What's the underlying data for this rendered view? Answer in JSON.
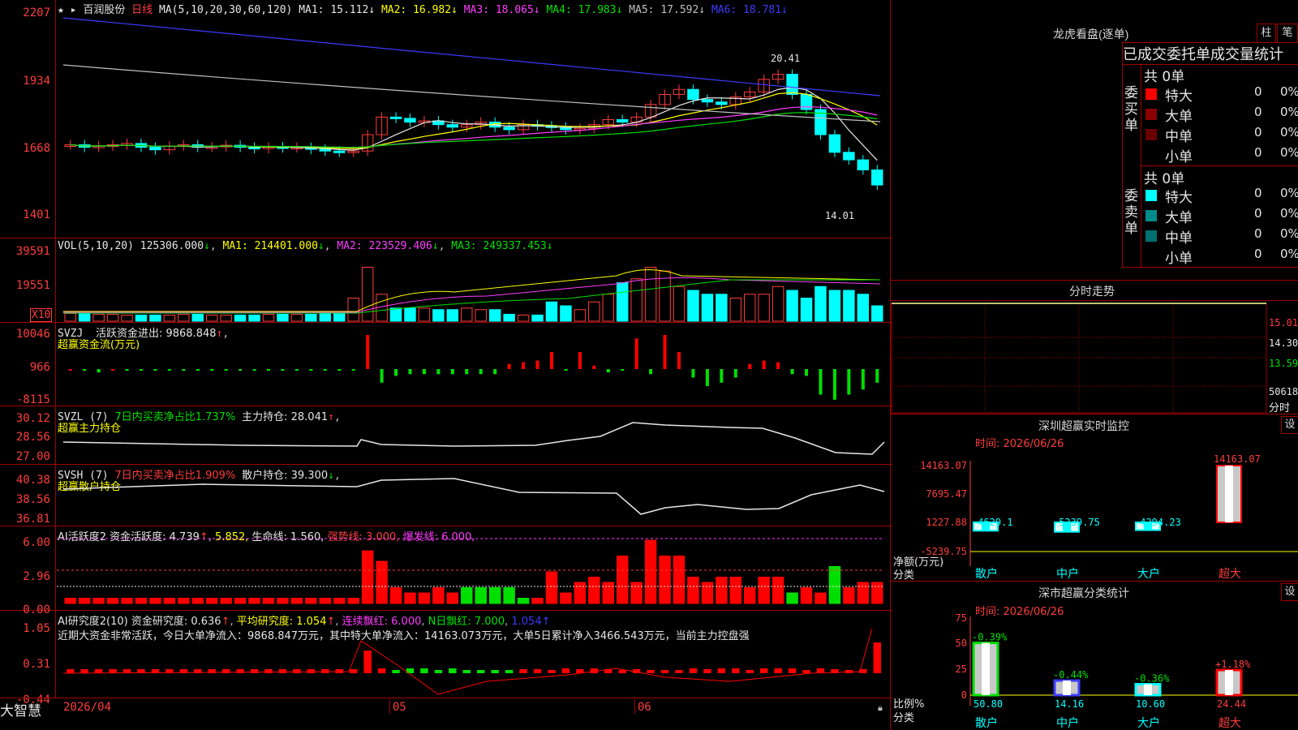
{
  "stock": {
    "name": "百润股份",
    "period": "日线",
    "ma_header": "MA(5,10,20,30,60,120)"
  },
  "ma_values": [
    {
      "label": "MA1: 15.112",
      "color": "#e6e6e6"
    },
    {
      "label": "MA2: 16.982",
      "color": "#ffff00"
    },
    {
      "label": "MA3: 18.065",
      "color": "#ff3cff"
    },
    {
      "label": "MA4: 17.983",
      "color": "#00e000"
    },
    {
      "label": "MA5: 17.592",
      "color": "#c0c0c0"
    },
    {
      "label": "MA6: 18.781",
      "color": "#3c3cff"
    }
  ],
  "price_axis": [
    "2207",
    "1934",
    "1668",
    "1401"
  ],
  "price_marks": {
    "high": "20.41",
    "low": "14.01"
  },
  "vol": {
    "header": "VOL(5,10,20)",
    "v": "125306.000",
    "ma1": "MA1: 214401.000",
    "ma2": "MA2: 223529.406",
    "ma3": "MA3: 249337.453",
    "axis": [
      "39591",
      "19551"
    ],
    "unit": "X10"
  },
  "svzj": {
    "header": "SVZJ",
    "line1": "活跃资金进出: 9868.848",
    "sub": "超赢资金流(万元)",
    "axis": [
      "10046",
      "966",
      "-8115"
    ]
  },
  "svzl": {
    "header": "SVZL (7)",
    "t1": "7日内买卖净占比1.737%",
    "t2": "主力持仓: 28.041",
    "sub": "超赢主力持仓",
    "axis": [
      "30.12",
      "28.56",
      "27.00"
    ]
  },
  "svsh": {
    "header": "SVSH (7)",
    "t1": "7日内买卖净占比1.909%",
    "t2": "散户持仓: 39.300",
    "sub": "超赢散户持仓",
    "axis": [
      "40.38",
      "38.56",
      "36.81"
    ]
  },
  "ai1": {
    "header": "AI活跃度2",
    "t1": "资金活跃度: 4.739",
    "t2": "5.852,",
    "t3": "生命线: 1.560,",
    "t4": "强势线: 3.000,",
    "t5": "爆发线: 6.000,",
    "axis": [
      "6.00",
      "2.96",
      "0.00"
    ]
  },
  "ai2": {
    "header": "AI研究度2(10)",
    "t1": "资金研究度: 0.636",
    "t2": "平均研究度: 1.054",
    "t3": "连续飘红: 6.000",
    "t4": "N日飘红: 7.000",
    "t5": "1.054",
    "note": "近期大资金非常活跃，今日大单净流入：9868.847万元，其中特大单净流入：14163.073万元，大单5日累计净入3466.543万元，当前主力控盘强",
    "axis": [
      "1.05",
      "0.31",
      "-0.44"
    ]
  },
  "bottom": {
    "brand": "大智慧",
    "date": "2026/04",
    "m05": "05",
    "m06": "06"
  },
  "dragon": {
    "title": "龙虎看盘(逐单)",
    "btn1": "柱",
    "btn2": "笔",
    "cols": "已成交委托单成交量统计",
    "buy": {
      "label": "委买单",
      "total": "共 0单",
      "rows": [
        {
          "name": "特大",
          "v": "0",
          "p": "0%",
          "color": "#ff0000"
        },
        {
          "name": "大单",
          "v": "0",
          "p": "0%",
          "color": "#8b0000"
        },
        {
          "name": "中单",
          "v": "0",
          "p": "0%",
          "color": "#6b0000"
        },
        {
          "name": "小单",
          "v": "0",
          "p": "0%",
          "color": "#000000"
        }
      ]
    },
    "sell": {
      "label": "委卖单",
      "total": "共 0单",
      "rows": [
        {
          "name": "特大",
          "v": "0",
          "p": "0%",
          "color": "#00ffff"
        },
        {
          "name": "大单",
          "v": "0",
          "p": "0%",
          "color": "#008b8b"
        },
        {
          "name": "中单",
          "v": "0",
          "p": "0%",
          "color": "#007070"
        },
        {
          "name": "小单",
          "v": "0",
          "p": "0%",
          "color": "#000000"
        }
      ]
    }
  },
  "intraday": {
    "title": "分时走势",
    "axis": [
      "15.01",
      "14.30",
      "13.59",
      "50618"
    ],
    "unit": "分时"
  },
  "monitor": {
    "title": "深圳超赢实时监控",
    "btn": "设",
    "date": "时间: 2026/06/26",
    "axis": [
      "14163.07",
      "7695.47",
      "1227.88",
      "-5239.75"
    ],
    "ylabel": "净额(万元)",
    "xlabel": "分类",
    "bars": [
      {
        "cat": "散户",
        "value": -4629.1,
        "label": "-4629.1"
      },
      {
        "cat": "中户",
        "value": -5239.75,
        "label": "-5239.75"
      },
      {
        "cat": "大户",
        "value": -4294.23,
        "label": "-4294.23"
      },
      {
        "cat": "超大",
        "value": 14163.07,
        "label": "14163.07"
      }
    ]
  },
  "classify": {
    "title": "深市超赢分类统计",
    "btn": "设",
    "date": "时间: 2026/06/26",
    "axis": [
      "75",
      "50",
      "25",
      "0"
    ],
    "ylabel": "比例%",
    "xlabel": "分类",
    "bars": [
      {
        "cat": "散户",
        "value": 50.8,
        "label": "50.80",
        "delta": "-0.39%"
      },
      {
        "cat": "中户",
        "value": 14.16,
        "label": "14.16",
        "delta": "-0.44%"
      },
      {
        "cat": "大户",
        "value": 10.6,
        "label": "10.60",
        "delta": "-0.36%"
      },
      {
        "cat": "超大",
        "value": 24.44,
        "label": "24.44",
        "delta": "+1.18%"
      }
    ]
  }
}
